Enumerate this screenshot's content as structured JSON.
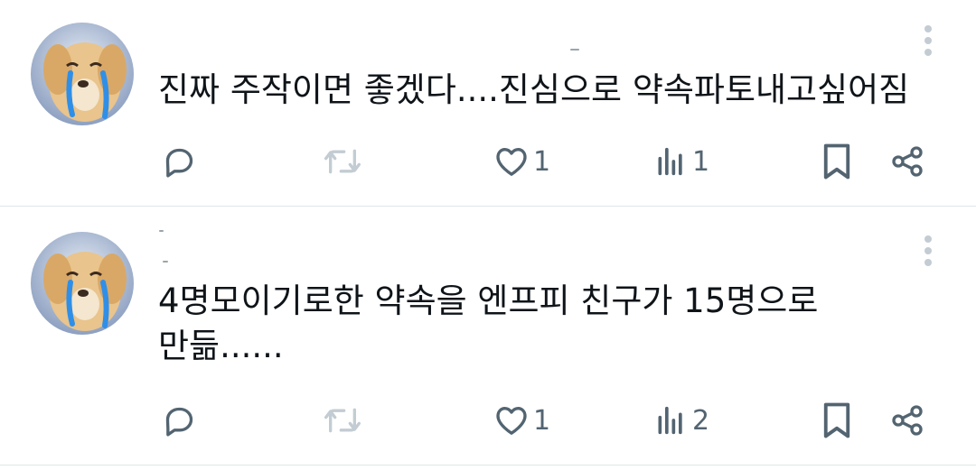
{
  "colors": {
    "icon": "#536471",
    "text": "#0f1419",
    "divider": "#e1e6ea",
    "more_dots": "#c3ccd3"
  },
  "posts": [
    {
      "text": "진짜 주작이면 좋겠다....진심으로 약속파토내고싶어짐",
      "likes": "1",
      "views": "1",
      "icons": [
        "reply-icon",
        "repost-icon",
        "like-icon",
        "views-icon",
        "bookmark-icon",
        "share-icon",
        "more-icon"
      ]
    },
    {
      "text": "4명모이기로한 약속을 엔프피 친구가 15명으로\n만듦......",
      "likes": "1",
      "views": "2",
      "icons": [
        "reply-icon",
        "repost-icon",
        "like-icon",
        "views-icon",
        "bookmark-icon",
        "share-icon",
        "more-icon"
      ]
    }
  ]
}
